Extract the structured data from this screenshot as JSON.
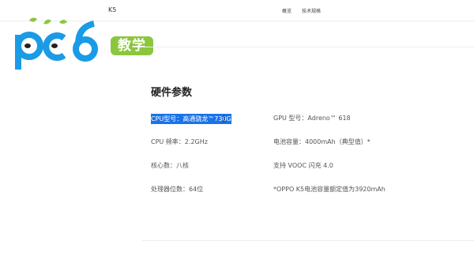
{
  "header": {
    "product": "K5",
    "nav": {
      "overview": "概览",
      "specs": "技术规格"
    }
  },
  "logo": {
    "text": "pc6",
    "badge": "教学"
  },
  "section": {
    "title": "硬件参数",
    "specs": {
      "cpu_model": "CPU型号：高通骁龙™730G",
      "gpu_model": "GPU 型号：Adreno™ 618",
      "cpu_freq": "CPU 频率：2.2GHz",
      "battery": "电池容量：4000mAh（典型值）*",
      "cores": "核心数：八核",
      "vooc": "支持 VOOC 闪充 4.0",
      "bits": "处理器位数：64位",
      "note": "*OPPO K5电池容量额定值为3920mAh"
    }
  },
  "colors": {
    "selection": "#1a73e8",
    "logo_blue": "#1a9be6",
    "logo_green": "#8cc63f"
  }
}
